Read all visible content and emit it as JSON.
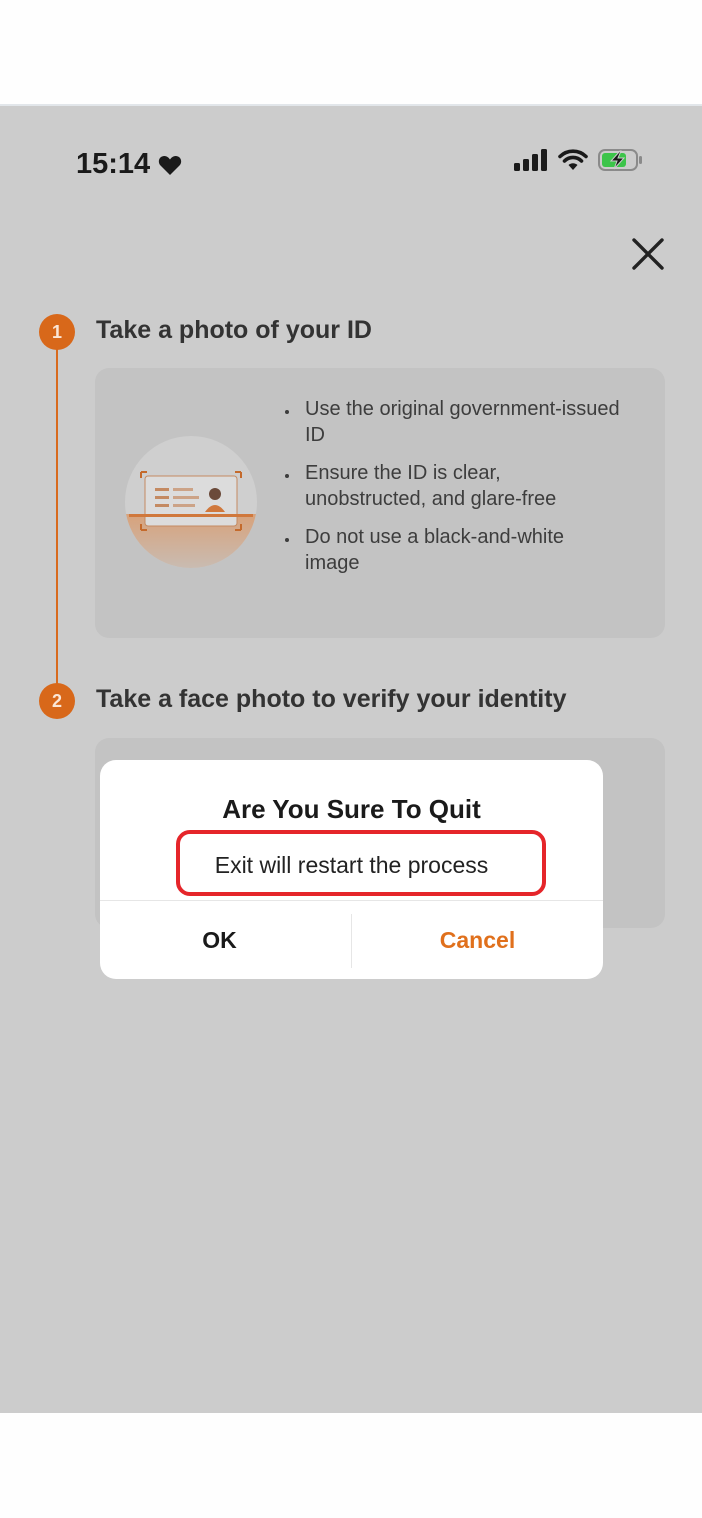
{
  "status_bar": {
    "time": "15:14",
    "heart_icon": "heart-icon",
    "signal_icon": "cellular-signal-icon",
    "wifi_icon": "wifi-icon",
    "battery_icon": "battery-charging-icon"
  },
  "header": {
    "close_icon": "close-icon"
  },
  "steps": [
    {
      "number": "1",
      "title": "Take a photo of your ID",
      "tips": [
        "Use the original government-issued ID",
        "Ensure the ID is clear, unobstructed, and glare-free",
        "Do not use a black-and-white image"
      ]
    },
    {
      "number": "2",
      "title": "Take a face photo to verify your identity"
    }
  ],
  "dialog": {
    "title": "Are You Sure To Quit",
    "message": "Exit will restart the process",
    "ok_label": "OK",
    "cancel_label": "Cancel"
  },
  "colors": {
    "accent": "#d8681a",
    "cancel_text": "#e0701c",
    "highlight": "#e5252a",
    "overlay_background": "#cccccc"
  }
}
